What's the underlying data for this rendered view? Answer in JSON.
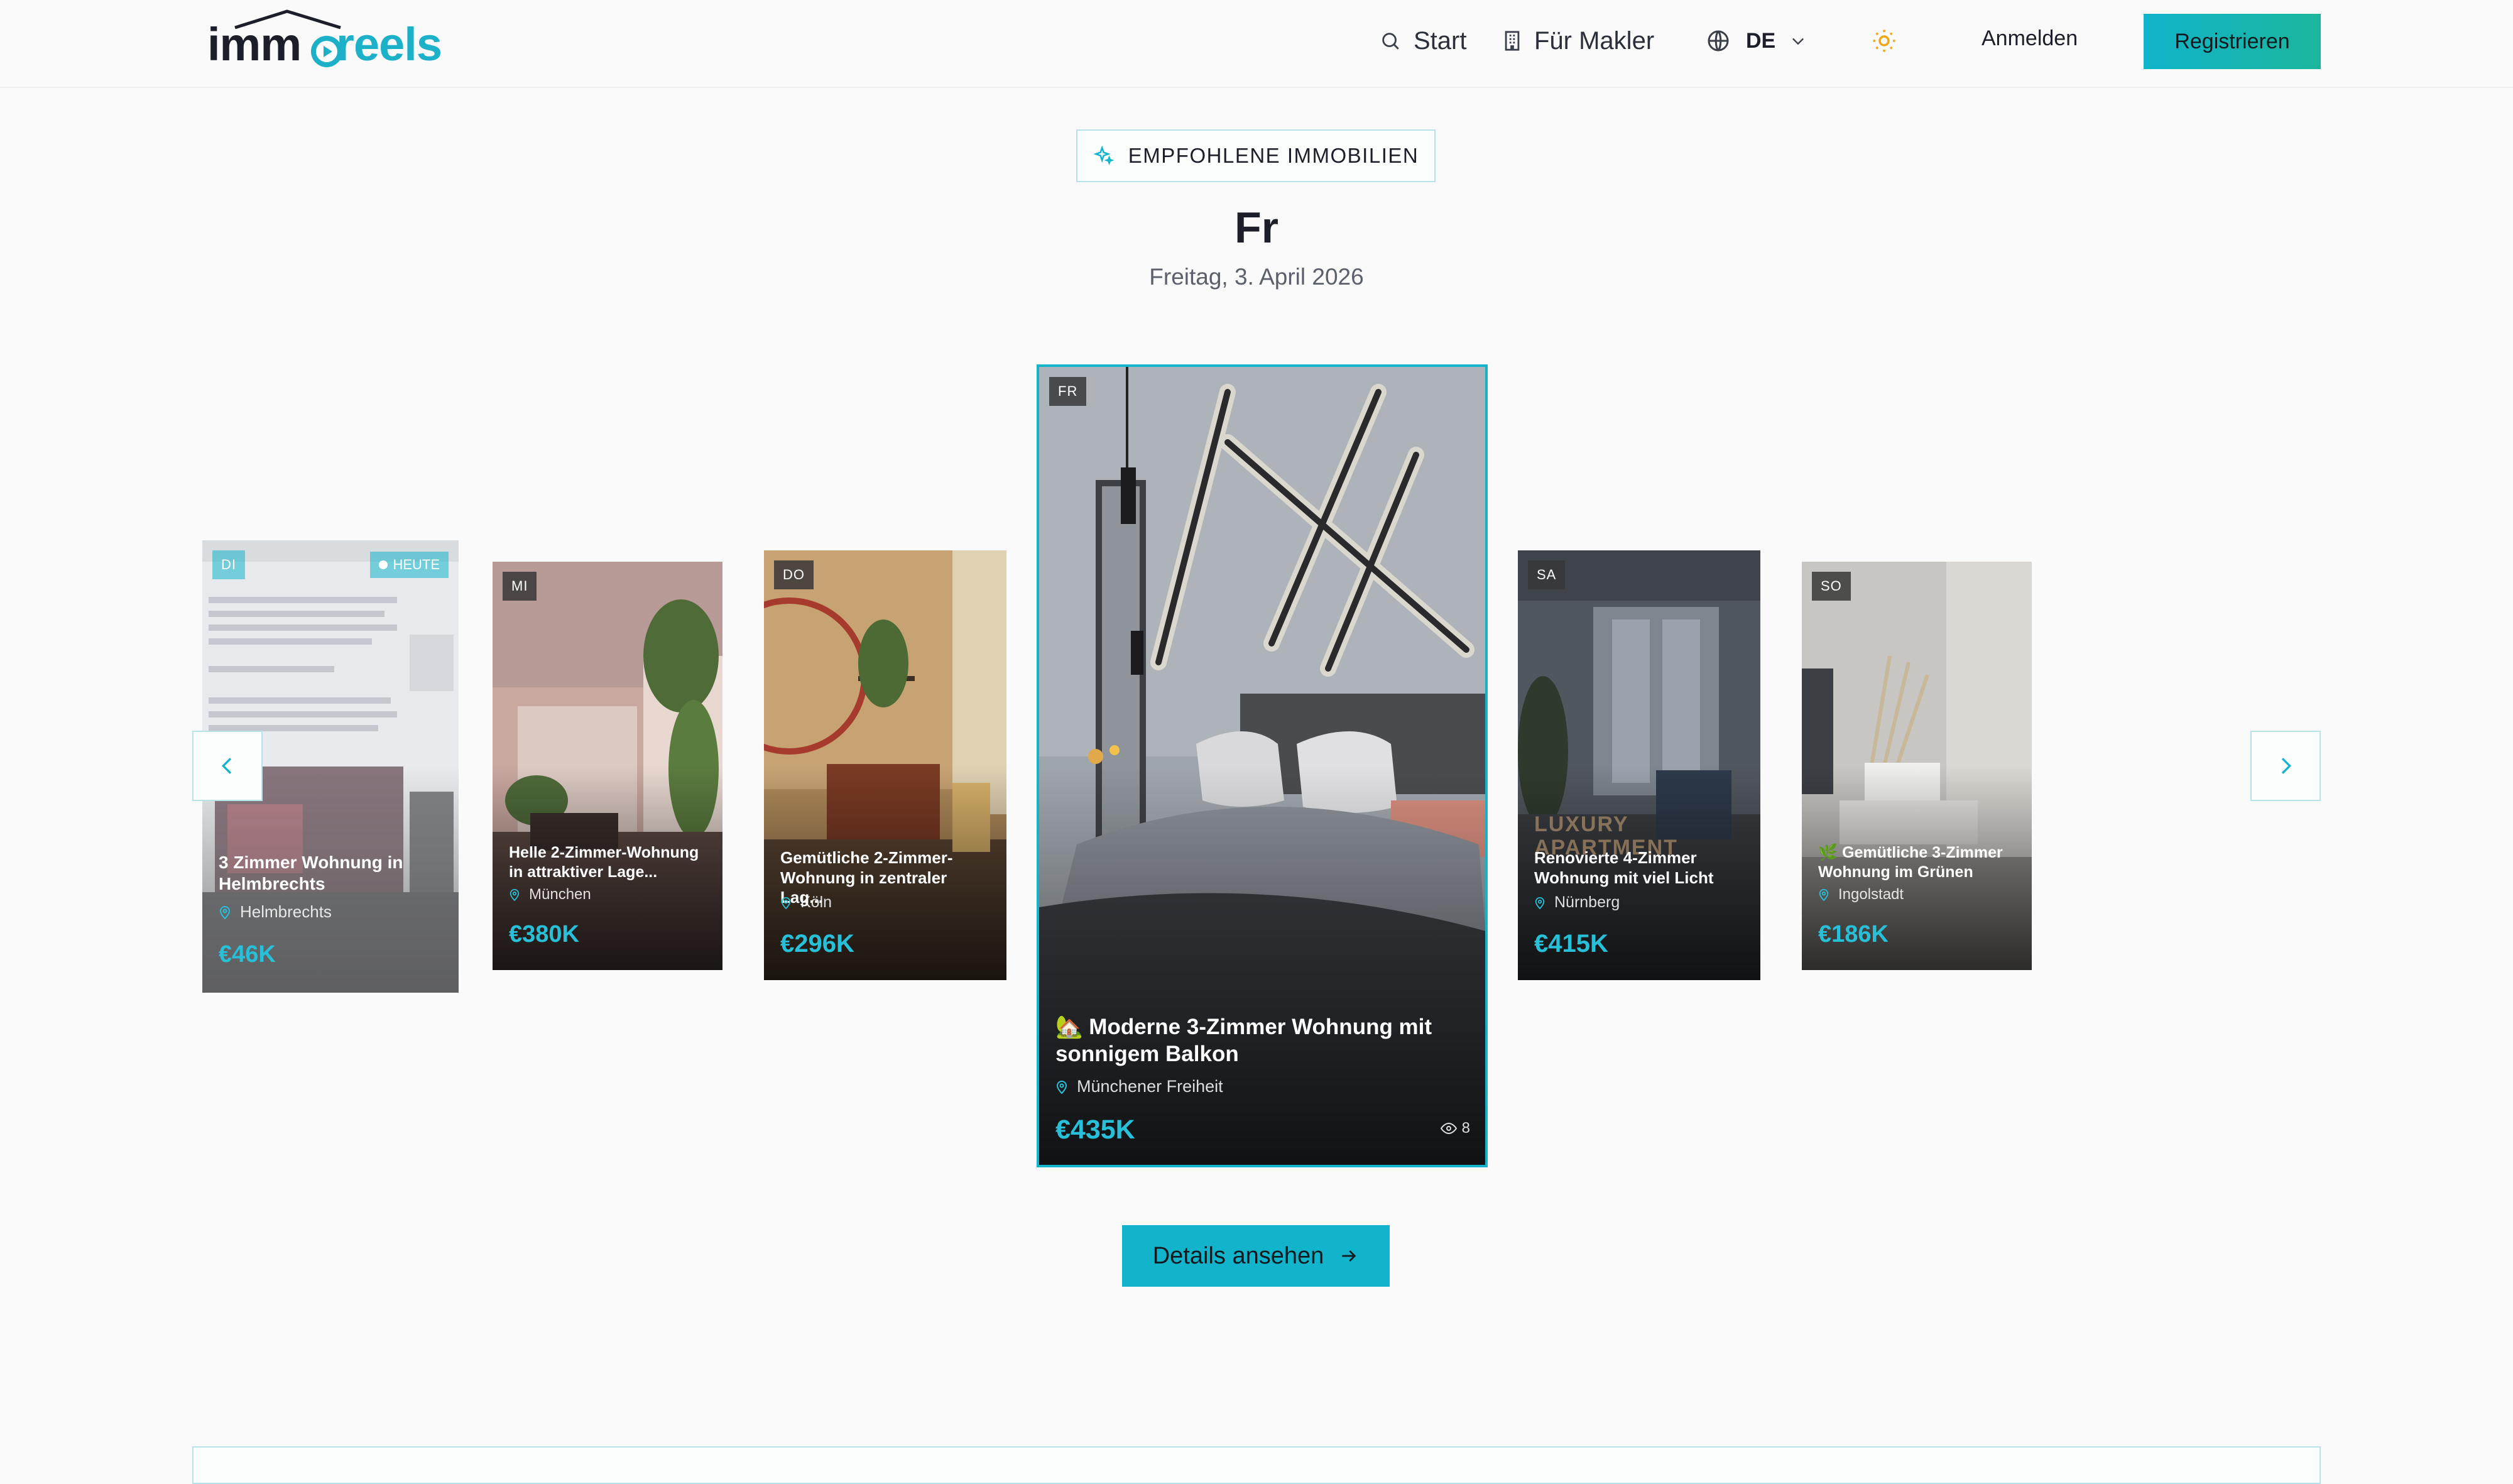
{
  "header": {
    "logo_dark": "imm",
    "logo_accent": "reels",
    "nav": [
      {
        "label": "Start",
        "icon": "search-icon"
      },
      {
        "label": "Für Makler",
        "icon": "building-icon"
      }
    ],
    "language": "DE",
    "login_label": "Anmelden",
    "register_label": "Registrieren"
  },
  "hero": {
    "badge": "EMPFOHLENE IMMOBILIEN",
    "day": "Fr",
    "date": "Freitag, 3. April 2026"
  },
  "cards": [
    {
      "day": "DI",
      "today_badge": "HEUTE",
      "title": "3 Zimmer Wohnung in Helmbrechts",
      "location": "Helmbrechts",
      "price": "€46K"
    },
    {
      "day": "MI",
      "title": "Helle 2-Zimmer-Wohnung in attraktiver Lage...",
      "location": "München",
      "price": "€380K"
    },
    {
      "day": "DO",
      "title": "Gemütliche 2-Zimmer-Wohnung in zentraler Lag...",
      "location": "Köln",
      "price": "€296K"
    },
    {
      "day": "FR",
      "title": "🏡 Moderne 3-Zimmer Wohnung mit sonnigem Balkon",
      "location": "Münchener Freiheit",
      "price": "€435K",
      "views": "8"
    },
    {
      "day": "SA",
      "title": "Renovierte 4-Zimmer Wohnung mit viel Licht",
      "location": "Nürnberg",
      "price": "€415K",
      "watermark": "LUXURY APARTMENT"
    },
    {
      "day": "SO",
      "title": "🌿 Gemütliche 3-Zimmer Wohnung im Grünen",
      "location": "Ingolstadt",
      "price": "€186K"
    }
  ],
  "details_label": "Details ansehen",
  "colors": {
    "accent": "#12b4cb",
    "price": "#27c0d8",
    "accent_border": "#b6e3ea"
  }
}
